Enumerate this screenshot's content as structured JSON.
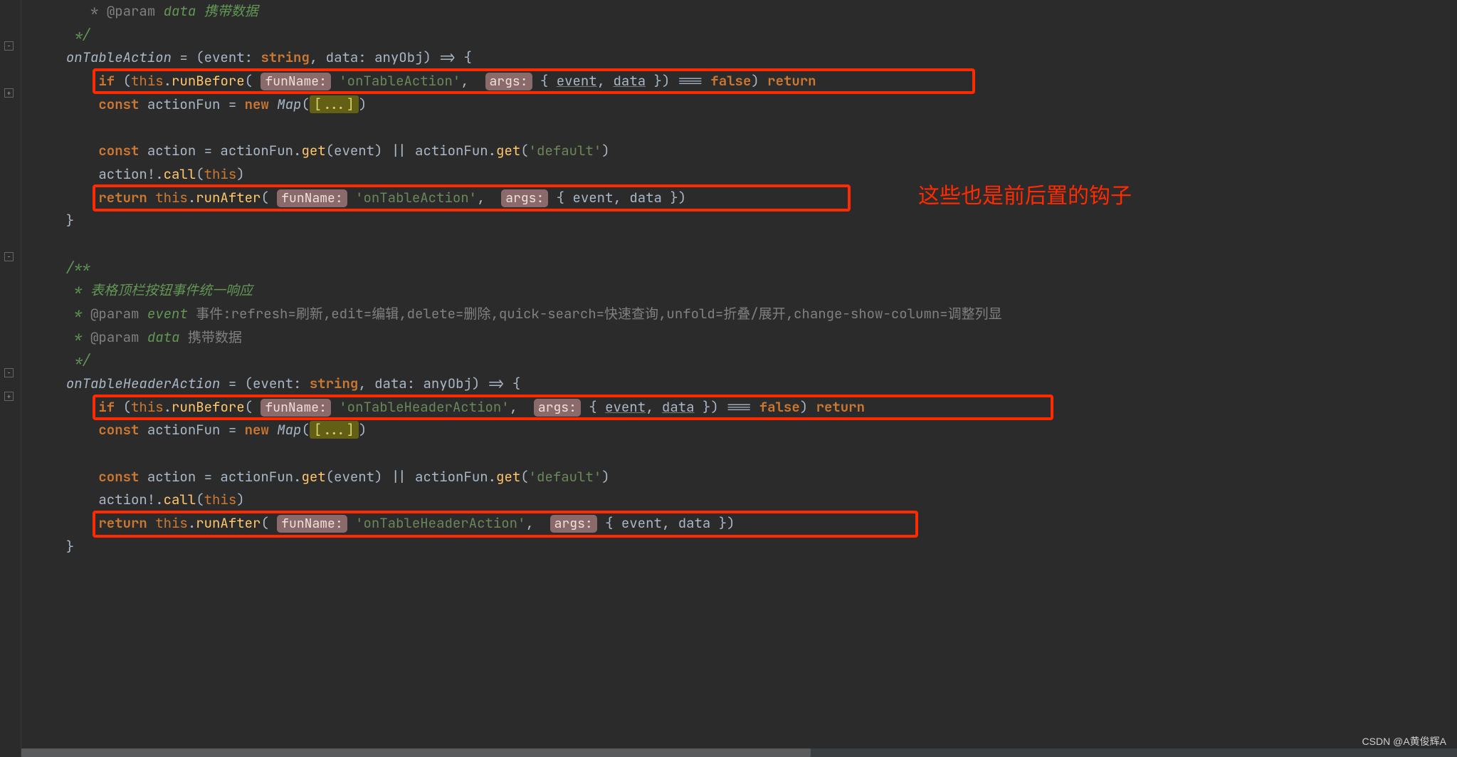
{
  "gutter": {
    "fold_plus": "+",
    "fold_minus": "−"
  },
  "annotation": {
    "text": "这些也是前后置的钩子"
  },
  "watermark": "CSDN @A黄俊辉A",
  "code": {
    "block1": {
      "comment_end": "   */",
      "sig_pre": "  ",
      "sig_name": "onTableAction",
      "sig_eq": " = (",
      "sig_p1": "event",
      "sig_colon1": ": ",
      "sig_type1": "string",
      "sig_comma": ", ",
      "sig_p2": "data",
      "sig_colon2": ": ",
      "sig_type2": "anyObj",
      "sig_arrow": ") => {",
      "body_indent": "      ",
      "if_kw": "if",
      "if_open": " (",
      "this_kw": "this",
      "dot": ".",
      "runBefore": "runBefore",
      "open2": "( ",
      "hint_funName": "funName:",
      "sp": " ",
      "str_onTableAction": "'onTableAction'",
      "comma2": ",  ",
      "hint_args": "args:",
      "obj_open": " { ",
      "event_u": "event",
      "comma3": ", ",
      "data_u": "data",
      "obj_close": " }) === ",
      "false_kw": "false",
      "close_if": ") ",
      "return_kw": "return",
      "const_kw": "const",
      "actionFun": " actionFun = ",
      "new_kw": "new",
      "map_cls": " Map",
      "map_open": "(",
      "fold_ellipsis": "[...]",
      "map_close": ")",
      "action_line_pre": "      ",
      "action_decl": " action = actionFun.",
      "get": "get",
      "get_arg": "(event) || actionFun.",
      "get2_arg": "(",
      "str_default": "'default'",
      "get2_close": ")",
      "action_call_pre": "      action!.",
      "call": "call",
      "call_arg": "(",
      "call_close": ")",
      "return_pre": "      ",
      "runAfter": "runAfter",
      "close_brace": "  }"
    },
    "doc2": {
      "open": "  /**",
      "l1": "   * 表格顶栏按钮事件统一响应",
      "l2a": "   * ",
      "l2_tag": "@param",
      "l2_name": " event ",
      "l2_desc": "事件:refresh=刷新,edit=编辑,delete=删除,quick-search=快速查询,unfold=折叠/展开,change-show-column=调整列显",
      "l3_name": " data ",
      "l3_desc": "携带数据",
      "close": "   */"
    },
    "block2": {
      "sig_name": "onTableHeaderAction",
      "str_onTableHeaderAction": "'onTableHeaderAction'"
    }
  }
}
